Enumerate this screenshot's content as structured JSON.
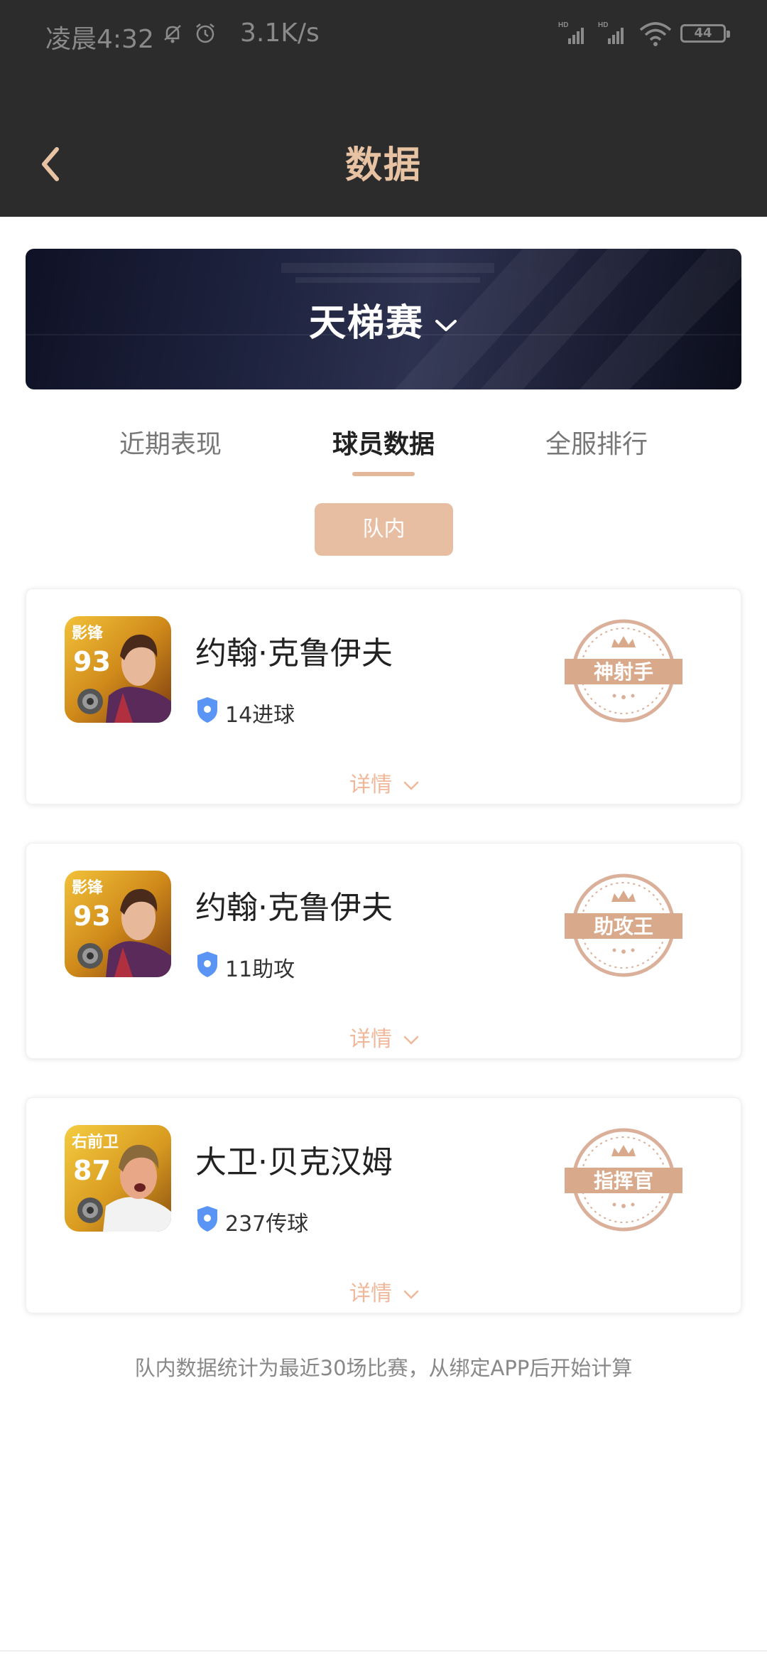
{
  "status_bar": {
    "time": "凌晨4:32",
    "speed": "3.1K/s",
    "battery": "44",
    "icons": [
      "mute-bell-icon",
      "alarm-icon",
      "hd-signal-icon",
      "hd-signal-icon",
      "wifi-icon",
      "battery-icon"
    ]
  },
  "header": {
    "title": "数据",
    "back_icon": "chevron-left-icon"
  },
  "banner": {
    "title": "天梯赛",
    "icon": "chevron-down-icon"
  },
  "tabs": [
    {
      "label": "近期表现",
      "active": false
    },
    {
      "label": "球员数据",
      "active": true
    },
    {
      "label": "全服排行",
      "active": false
    }
  ],
  "filter": {
    "label": "队内"
  },
  "players": [
    {
      "position": "影锋",
      "rating": "93",
      "name": "约翰·克鲁伊夫",
      "stat": "14进球",
      "badge": "神射手",
      "detail": "详情"
    },
    {
      "position": "影锋",
      "rating": "93",
      "name": "约翰·克鲁伊夫",
      "stat": "11助攻",
      "badge": "助攻王",
      "detail": "详情"
    },
    {
      "position": "右前卫",
      "rating": "87",
      "name": "大卫·贝克汉姆",
      "stat": "237传球",
      "badge": "指挥官",
      "detail": "详情"
    }
  ],
  "footnote": "队内数据统计为最近30场比赛，从绑定APP后开始计算",
  "colors": {
    "header_bg": "#2c2c2c",
    "title": "#e8c3a3",
    "accent": "#e2b79a",
    "pill": "#e8bea2",
    "badge": "#d9a98c",
    "detail": "#f0b89a",
    "shield": "#5a95f5"
  }
}
